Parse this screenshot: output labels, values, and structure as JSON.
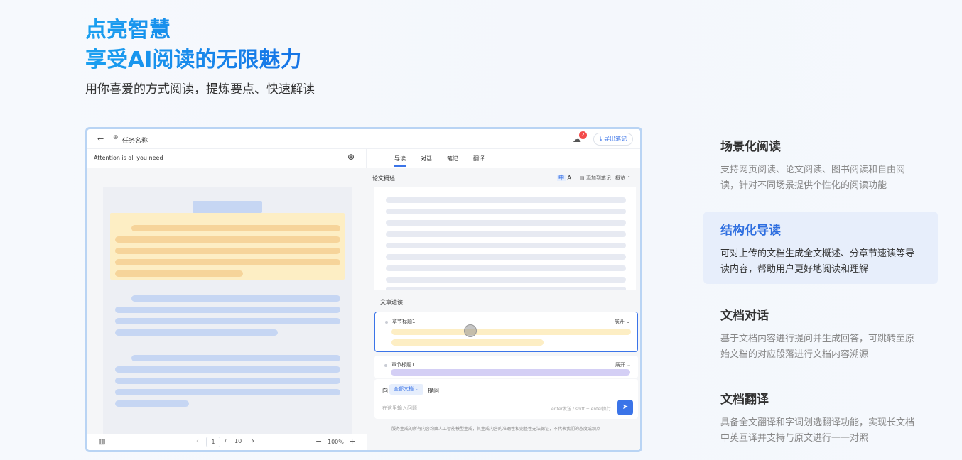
{
  "hero": {
    "title_line1": "点亮智慧",
    "title_line2": "享受AI阅读的无限魅力",
    "subtitle": "用你喜爱的方式阅读，提炼要点、快速解读"
  },
  "app": {
    "task_name": "任务名称",
    "notification_count": "2",
    "export_label": "导出笔记",
    "doc_title": "Attention is all you need",
    "tabs": [
      {
        "label": "导读"
      },
      {
        "label": "对话"
      },
      {
        "label": "笔记"
      },
      {
        "label": "翻译"
      }
    ],
    "summary_title": "论文概述",
    "lang_zh": "中",
    "lang_en": "A",
    "add_note_label": "添加到笔记",
    "overview_label": "概览",
    "quick_read_title": "文章速读",
    "chapters": [
      {
        "label": "章节标题1",
        "expand": "展开"
      },
      {
        "label": "章节标题1",
        "expand": "展开"
      }
    ],
    "ask": {
      "to": "向",
      "scope": "全部文档",
      "question": "提问",
      "placeholder": "在这里输入问题",
      "hint": "enter发送 / shift + enter换行"
    },
    "disclaimer": "服务生成的所有内容均由人工智能模型生成，其生成内容的准确性和完整性无法保证，不代表我们的态度或观点",
    "pagination": {
      "current": "1",
      "separator": "/",
      "total": "10",
      "zoom": "100%"
    }
  },
  "features": [
    {
      "title": "场景化阅读",
      "desc": "支持网页阅读、论文阅读、图书阅读和自由阅读，针对不同场景提供个性化的阅读功能"
    },
    {
      "title": "结构化导读",
      "desc": "可对上传的文档生成全文概述、分章节速读等导读内容，帮助用户更好地阅读和理解"
    },
    {
      "title": "文档对话",
      "desc": "基于文档内容进行提问并生成回答，可跳转至原始文档的对应段落进行文档内容溯源"
    },
    {
      "title": "文档翻译",
      "desc": "具备全文翻译和字词划选翻译功能，实现长文档中英互译并支持与原文进行一一对照"
    }
  ],
  "colors": {
    "accent": "#3b74e8",
    "title_gradient_start": "#1aa0f0",
    "title_gradient_end": "#1573e6",
    "active_feature_bg": "#e7eefb"
  }
}
